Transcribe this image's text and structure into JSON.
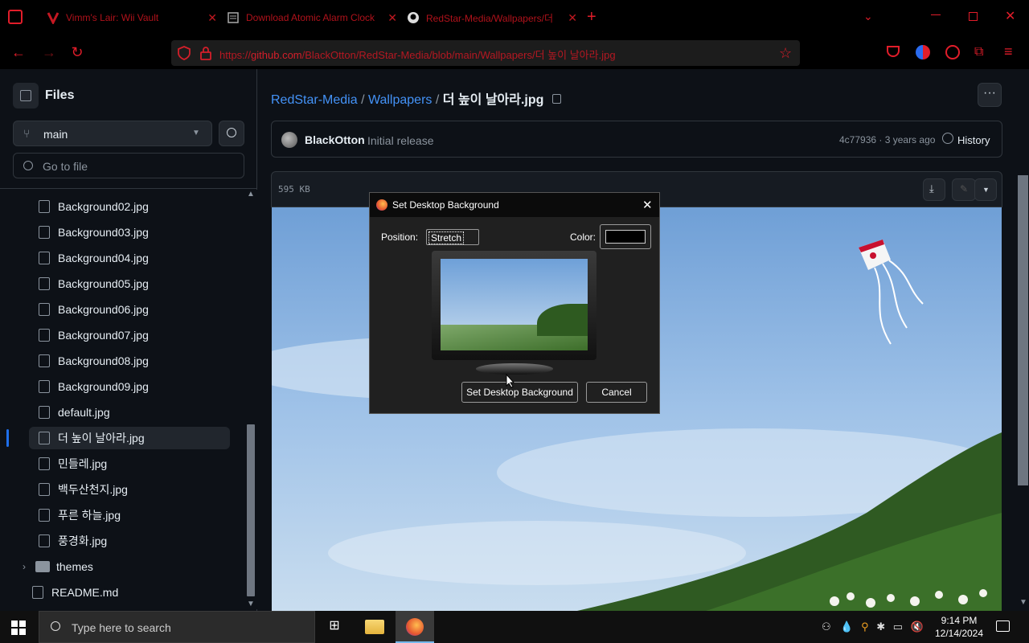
{
  "browser": {
    "tabs": [
      {
        "title": "Vimm's Lair: Wii Vault",
        "icon": "red-v-icon"
      },
      {
        "title": "Download Atomic Alarm Clock",
        "icon": "document-icon"
      },
      {
        "title": "RedStar-Media/Wallpapers/더",
        "icon": "github-icon"
      }
    ],
    "new_tab": "+",
    "url_prefix": "https://",
    "url_domain": "github.com",
    "url_path": "/BlackOtton/RedStar-Media/blob/main/Wallpapers/더 높이 날아라.jpg"
  },
  "sidebar": {
    "title": "Files",
    "branch": "main",
    "search_placeholder": "Go to file",
    "files": [
      {
        "name": "Background02.jpg",
        "type": "file"
      },
      {
        "name": "Background03.jpg",
        "type": "file"
      },
      {
        "name": "Background04.jpg",
        "type": "file"
      },
      {
        "name": "Background05.jpg",
        "type": "file"
      },
      {
        "name": "Background06.jpg",
        "type": "file"
      },
      {
        "name": "Background07.jpg",
        "type": "file"
      },
      {
        "name": "Background08.jpg",
        "type": "file"
      },
      {
        "name": "Background09.jpg",
        "type": "file"
      },
      {
        "name": "default.jpg",
        "type": "file"
      },
      {
        "name": "더 높이 날아라.jpg",
        "type": "file",
        "selected": true
      },
      {
        "name": "민들레.jpg",
        "type": "file"
      },
      {
        "name": "백두산천지.jpg",
        "type": "file"
      },
      {
        "name": "푸른 하늘.jpg",
        "type": "file"
      },
      {
        "name": "풍경화.jpg",
        "type": "file"
      }
    ],
    "folder": "themes",
    "readme": "README.md"
  },
  "breadcrumb": {
    "repo": "RedStar-Media",
    "sep1": "/",
    "folder": "Wallpapers",
    "sep2": "/",
    "file": "더 높이 날아라.jpg"
  },
  "commit": {
    "author": "BlackOtton",
    "message": "Initial release",
    "meta": "4c77936 · 3 years ago",
    "history": "History"
  },
  "file_info": {
    "size": "595 KB"
  },
  "dialog": {
    "title": "Set Desktop Background",
    "position_label": "Position:",
    "position_value": "Stretch",
    "color_label": "Color:",
    "color_value": "#000000",
    "set_button": "Set Desktop Background",
    "cancel_button": "Cancel"
  },
  "taskbar": {
    "search_placeholder": "Type here to search",
    "time": "9:14 PM",
    "date": "12/14/2024"
  },
  "colors": {
    "accent_red": "#e11d2a",
    "link_blue": "#4493f8",
    "bg": "#0d1117"
  }
}
